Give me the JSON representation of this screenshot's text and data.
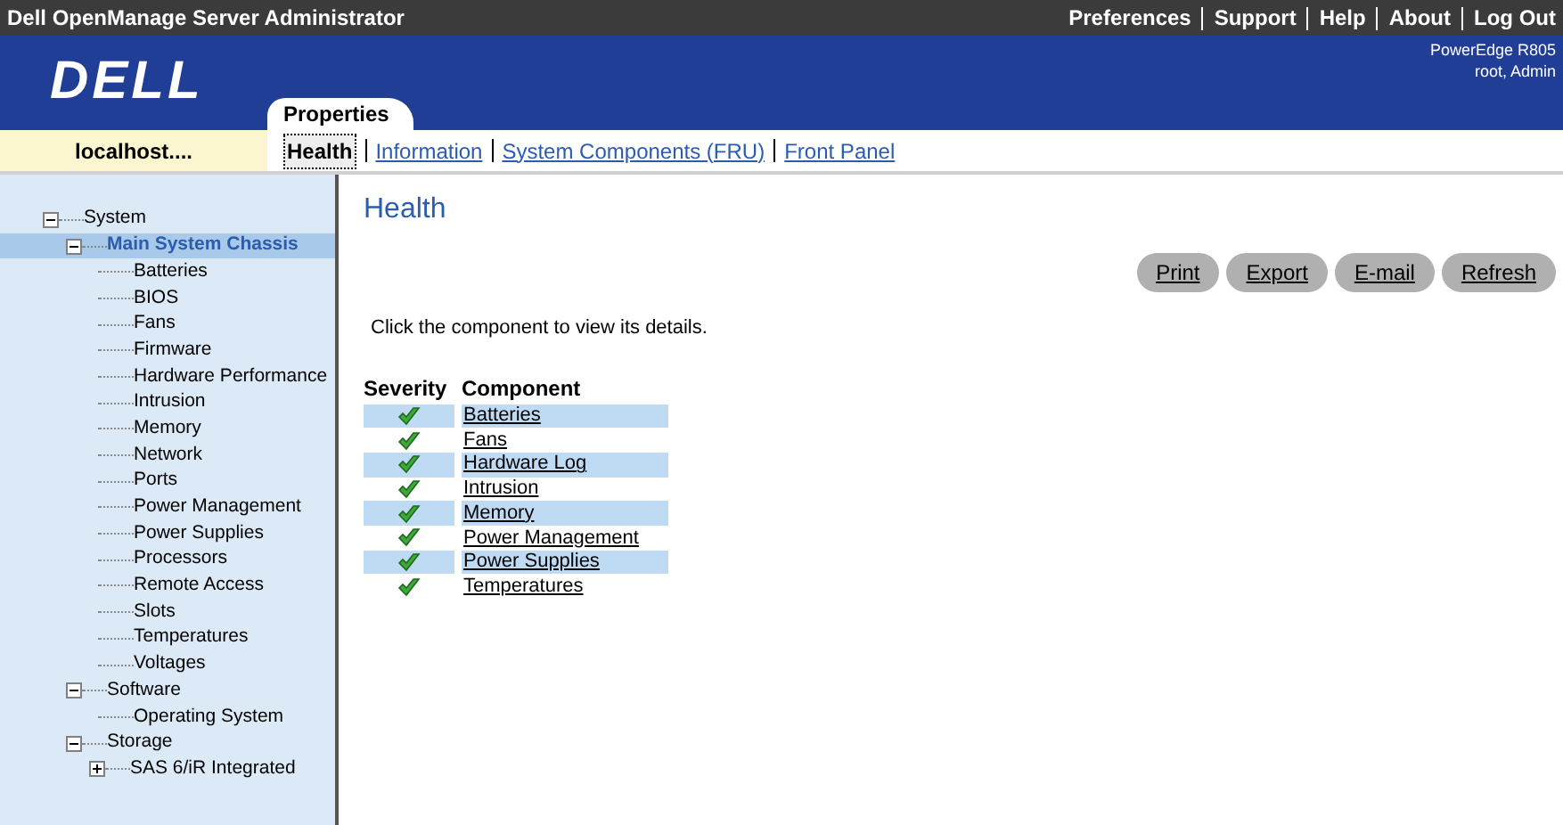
{
  "window": {
    "title": "Dell OpenManage Server Administrator"
  },
  "top_links": [
    "Preferences",
    "Support",
    "Help",
    "About",
    "Log Out"
  ],
  "header": {
    "logo": "DELL",
    "server_model": "PowerEdge R805",
    "user": "root, Admin"
  },
  "main_tab": {
    "label": "Properties",
    "selected": true
  },
  "host": "localhost....",
  "subtabs": [
    {
      "label": "Health",
      "selected": true
    },
    {
      "label": "Information",
      "selected": false
    },
    {
      "label": "System Components (FRU)",
      "selected": false
    },
    {
      "label": "Front Panel",
      "selected": false
    }
  ],
  "tree": [
    {
      "label": "System",
      "expanded": true,
      "selected": false,
      "children": [
        {
          "label": "Main System Chassis",
          "expanded": true,
          "selected": true,
          "children": [
            {
              "label": "Batteries",
              "selected": false
            },
            {
              "label": "BIOS",
              "selected": false
            },
            {
              "label": "Fans",
              "selected": false
            },
            {
              "label": "Firmware",
              "selected": false
            },
            {
              "label": "Hardware Performance",
              "selected": false
            },
            {
              "label": "Intrusion",
              "selected": false
            },
            {
              "label": "Memory",
              "selected": false
            },
            {
              "label": "Network",
              "selected": false
            },
            {
              "label": "Ports",
              "selected": false
            },
            {
              "label": "Power Management",
              "selected": false
            },
            {
              "label": "Power Supplies",
              "selected": false
            },
            {
              "label": "Processors",
              "selected": false
            },
            {
              "label": "Remote Access",
              "selected": false
            },
            {
              "label": "Slots",
              "selected": false
            },
            {
              "label": "Temperatures",
              "selected": false
            },
            {
              "label": "Voltages",
              "selected": false
            }
          ]
        },
        {
          "label": "Software",
          "expanded": true,
          "selected": false,
          "children": [
            {
              "label": "Operating System",
              "selected": false
            }
          ]
        },
        {
          "label": "Storage",
          "expanded": true,
          "selected": false,
          "children": [
            {
              "label": "SAS 6/iR Integrated",
              "expanded": false,
              "selected": false
            }
          ]
        }
      ]
    }
  ],
  "page_title": "Health",
  "actions": [
    "Print",
    "Export",
    "E-mail",
    "Refresh"
  ],
  "instructions": "Click the component to view its details.",
  "table": {
    "columns": [
      "Severity",
      "Component"
    ],
    "rows": [
      {
        "kind": "ok",
        "component": "Batteries"
      },
      {
        "kind": "ok",
        "component": "Fans"
      },
      {
        "kind": "ok",
        "component": "Hardware Log"
      },
      {
        "kind": "ok",
        "component": "Intrusion"
      },
      {
        "kind": "ok",
        "component": "Memory"
      },
      {
        "kind": "ok",
        "component": "Power Management"
      },
      {
        "kind": "ok",
        "component": "Power Supplies"
      },
      {
        "kind": "ok",
        "component": "Temperatures"
      }
    ]
  }
}
